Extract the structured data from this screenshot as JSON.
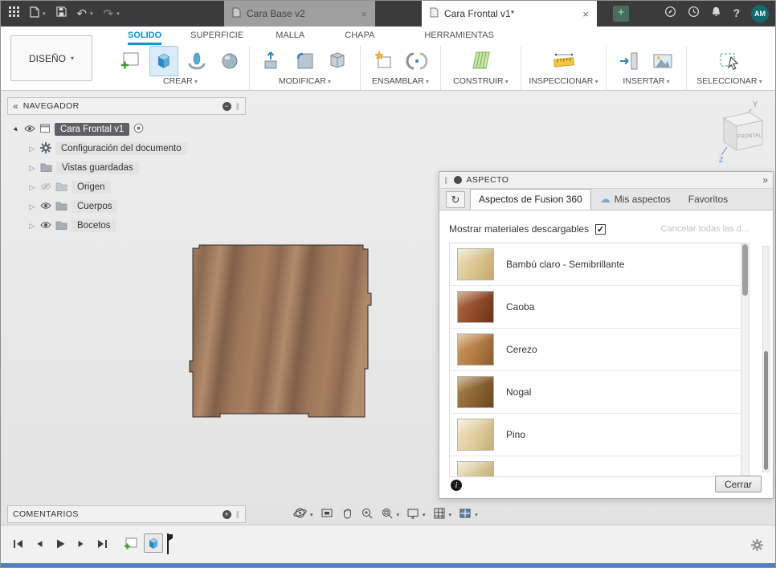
{
  "colors": {
    "accent_blue": "#0696d7",
    "titlebar_bg": "#3b3b3b",
    "canvas_bg": "#eaeaea",
    "selection_pill": "#5d6166",
    "bottom_strip": "#4c80c0",
    "wood_tones": [
      "#a8805f",
      "#8d6950",
      "#b28b6b",
      "#7f5f49",
      "#9c7659"
    ]
  },
  "titlebar": {
    "close_glyph": "×",
    "new_tab_glyph": "+",
    "document_tabs": [
      {
        "label": "Cara Base v2"
      },
      {
        "label": "Cara Frontal v1*"
      }
    ],
    "avatar_initials": "AM"
  },
  "ribbon": {
    "workspace_label": "DISEÑO",
    "tabs": [
      {
        "label": "SOLIDO"
      },
      {
        "label": "SUPERFICIE"
      },
      {
        "label": "MALLA"
      },
      {
        "label": "CHAPA"
      },
      {
        "label": "HERRAMIENTAS"
      }
    ],
    "groups": [
      {
        "label": "CREAR"
      },
      {
        "label": "MODIFICAR"
      },
      {
        "label": "ENSAMBLAR"
      },
      {
        "label": "CONSTRUIR"
      },
      {
        "label": "INSPECCIONAR"
      },
      {
        "label": "INSERTAR"
      },
      {
        "label": "SELECCIONAR"
      }
    ]
  },
  "navigator": {
    "title": "NAVEGADOR",
    "root_label": "Cara Frontal v1",
    "items": [
      {
        "label": "Configuración del documento"
      },
      {
        "label": "Vistas guardadas"
      },
      {
        "label": "Origen"
      },
      {
        "label": "Cuerpos"
      },
      {
        "label": "Bocetos"
      }
    ]
  },
  "viewcube": {
    "face_label": "FRONTAL",
    "axis_y": "Y",
    "axis_z": "Z"
  },
  "aspect_dialog": {
    "title": "ASPECTO",
    "tabs": [
      {
        "label": "Aspectos de Fusion 360"
      },
      {
        "label": "Mis aspectos"
      },
      {
        "label": "Favoritos"
      }
    ],
    "show_downloadable_label": "Mostrar materiales descargables",
    "cancel_downloads_label": "Cancelar todas las d...",
    "materials": [
      {
        "label": "Bambú claro - Semibrillante",
        "tones": [
          "#eadcb2",
          "#d9c48e",
          "#c3a868"
        ]
      },
      {
        "label": "Caoba",
        "tones": [
          "#b06a42",
          "#8e4a28",
          "#6b3218"
        ]
      },
      {
        "label": "Cerezo",
        "tones": [
          "#cf9a62",
          "#b27a42",
          "#8d5c2c"
        ]
      },
      {
        "label": "Nogal",
        "tones": [
          "#a98049",
          "#8a6231",
          "#6a481f"
        ]
      },
      {
        "label": "Pino",
        "tones": [
          "#efe3c0",
          "#dfcc9c",
          "#c5ac76"
        ]
      },
      {
        "label": "",
        "tones": [
          "#e8dcba",
          "#d6c494",
          "#bfa76e"
        ]
      }
    ],
    "close_label": "Cerrar"
  },
  "comments_panel": {
    "title": "COMENTARIOS"
  }
}
